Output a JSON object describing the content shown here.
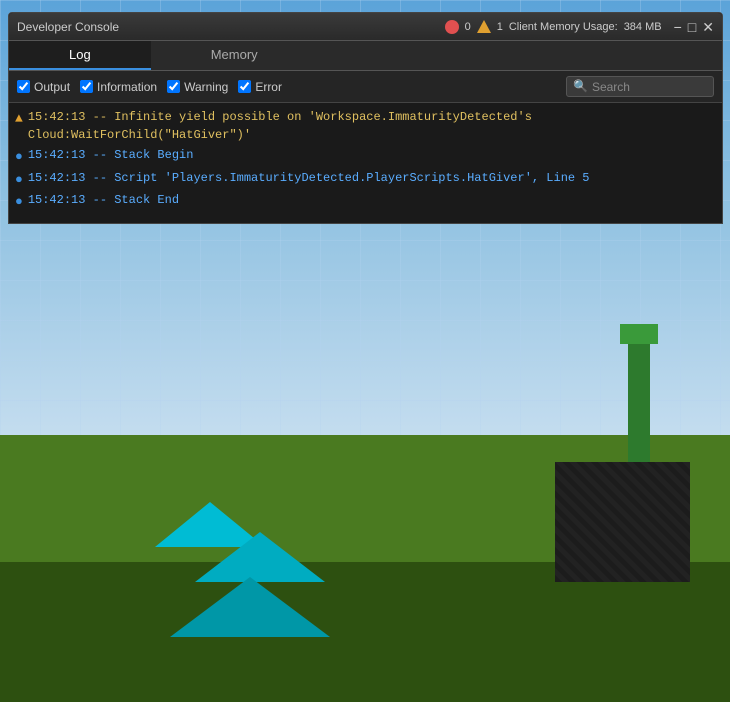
{
  "window": {
    "title": "Developer Console",
    "memory_usage_label": "Client Memory Usage:",
    "memory_value": "384 MB",
    "error_count": "0",
    "warning_count": "1"
  },
  "tabs": [
    {
      "id": "log",
      "label": "Log",
      "active": true
    },
    {
      "id": "memory",
      "label": "Memory",
      "active": false
    }
  ],
  "toolbar": {
    "output_label": "Output",
    "information_label": "Information",
    "warning_label": "Warning",
    "error_label": "Error",
    "search_placeholder": "Search"
  },
  "log_entries": [
    {
      "type": "warning",
      "text": "15:42:13 -- Infinite yield possible on 'Workspace.ImmaturityDetected's Cloud:WaitForChild(\"HatGiver\")'",
      "icon": "▲"
    },
    {
      "type": "info",
      "text": "15:42:13 -- Stack Begin",
      "icon": "ℹ"
    },
    {
      "type": "info",
      "text": "15:42:13 -- Script 'Players.ImmaturityDetected.PlayerScripts.HatGiver', Line 5",
      "icon": "ℹ"
    },
    {
      "type": "info",
      "text": "15:42:13 -- Stack End",
      "icon": "ℹ"
    }
  ],
  "colors": {
    "accent_blue": "#3a8fdf",
    "warning_yellow": "#e0a030",
    "info_blue": "#5aadff",
    "log_warning_text": "#e0c060",
    "log_info_text": "#5aadff"
  }
}
